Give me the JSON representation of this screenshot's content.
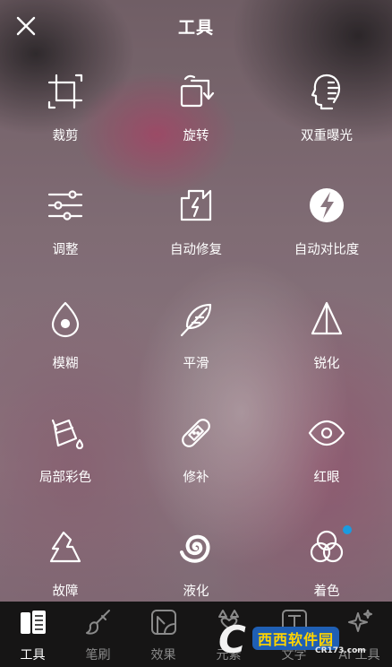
{
  "header": {
    "title": "工具",
    "close_icon": "close-icon"
  },
  "tools": [
    {
      "label": "裁剪",
      "icon": "crop-icon"
    },
    {
      "label": "旋转",
      "icon": "rotate-icon"
    },
    {
      "label": "双重曝光",
      "icon": "double-exposure-icon"
    },
    {
      "label": "调整",
      "icon": "adjust-sliders-icon"
    },
    {
      "label": "自动修复",
      "icon": "auto-fix-icon"
    },
    {
      "label": "自动对比度",
      "icon": "auto-contrast-icon"
    },
    {
      "label": "模糊",
      "icon": "blur-icon"
    },
    {
      "label": "平滑",
      "icon": "smooth-feather-icon"
    },
    {
      "label": "锐化",
      "icon": "sharpen-icon"
    },
    {
      "label": "局部彩色",
      "icon": "paint-bucket-icon"
    },
    {
      "label": "修补",
      "icon": "bandage-icon"
    },
    {
      "label": "红眼",
      "icon": "eye-icon"
    },
    {
      "label": "故障",
      "icon": "glitch-icon"
    },
    {
      "label": "液化",
      "icon": "liquify-swirl-icon"
    },
    {
      "label": "着色",
      "icon": "color-circles-icon",
      "badge_color": "#1a9be0"
    }
  ],
  "bottom_tabs": [
    {
      "label": "工具",
      "icon": "tools-icon",
      "active": true
    },
    {
      "label": "笔刷",
      "icon": "brush-icon"
    },
    {
      "label": "效果",
      "icon": "effects-icon"
    },
    {
      "label": "元素",
      "icon": "stickers-icon"
    },
    {
      "label": "文字",
      "icon": "text-icon"
    },
    {
      "label": "AI 工具",
      "icon": "ai-sparkle-icon"
    }
  ],
  "watermark": {
    "brand": "西西软件园",
    "site": "CR173.com"
  },
  "colors": {
    "accent_dot": "#1a9be0",
    "bottom_bar": "#121212",
    "inactive_tab": "#8a8a8a"
  }
}
